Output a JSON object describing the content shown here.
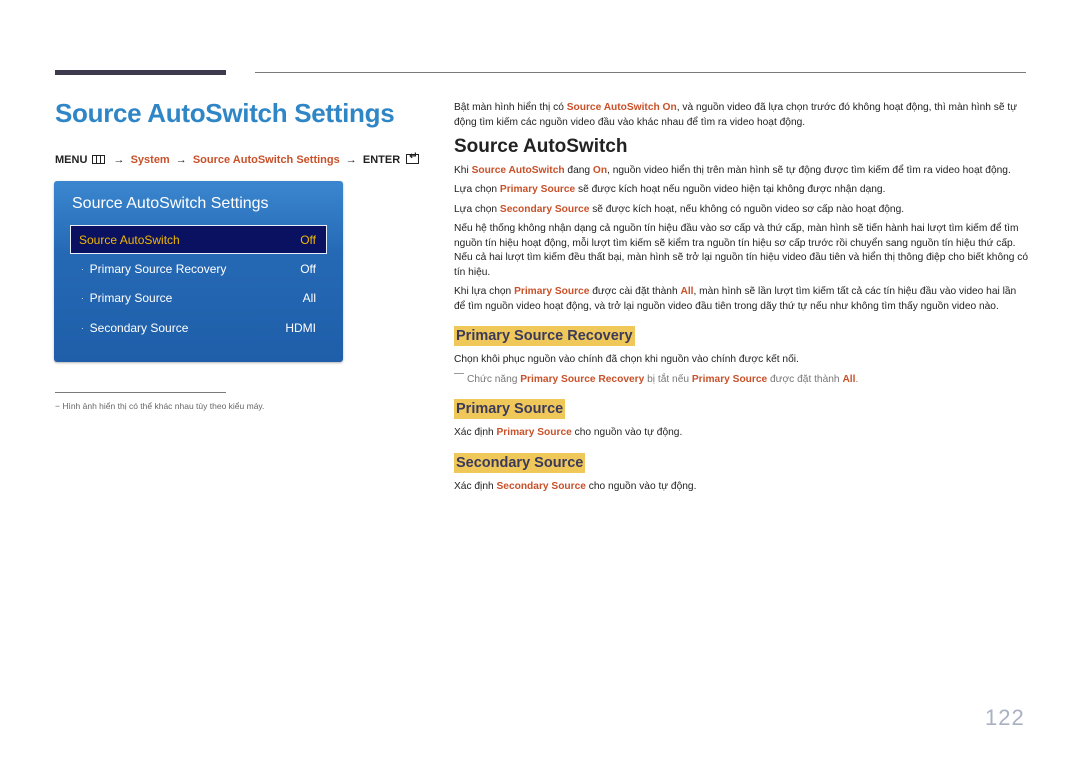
{
  "header": {
    "title": "Source AutoSwitch Settings"
  },
  "menu_path": {
    "menu": "MENU",
    "arrow": "→",
    "system": "System",
    "settings": "Source AutoSwitch Settings",
    "enter": "ENTER"
  },
  "osd": {
    "title": "Source AutoSwitch Settings",
    "rows": [
      {
        "label": "Source AutoSwitch",
        "value": "Off",
        "selected": true
      },
      {
        "label": "Primary Source Recovery",
        "value": "Off"
      },
      {
        "label": "Primary Source",
        "value": "All"
      },
      {
        "label": "Secondary Source",
        "value": "HDMI"
      }
    ],
    "dot": "·"
  },
  "footnote": "−  Hình ảnh hiển thị có thể khác nhau tùy theo kiểu máy.",
  "intro": {
    "pre": "Bật màn hình hiển thị có ",
    "hl": "Source AutoSwitch On",
    "post": ", và nguồn video đã lựa chọn trước đó không hoạt động, thì màn hình sẽ tự động tìm kiếm các nguồn video đầu vào khác nhau để tìm ra video hoạt động."
  },
  "section_autoswitch": {
    "heading": "Source AutoSwitch",
    "p1": {
      "a": "Khi ",
      "b": "Source AutoSwitch",
      "c": " đang ",
      "d": "On",
      "e": ", nguồn video hiển thị trên màn hình sẽ tự động được tìm kiếm để tìm ra video hoạt động."
    },
    "p2": {
      "a": "Lựa chọn ",
      "b": "Primary Source",
      "c": " sẽ được kích hoạt nếu nguồn video hiện tại không được nhận dạng."
    },
    "p3": {
      "a": "Lựa chọn ",
      "b": "Secondary Source",
      "c": " sẽ được kích hoạt, nếu không có nguồn video sơ cấp nào hoạt động."
    },
    "p4": "Nếu hệ thống không nhận dạng cả nguồn tín hiệu đầu vào sơ cấp và thứ cấp, màn hình sẽ tiến hành hai lượt tìm kiếm để tìm nguồn tín hiệu hoạt động, mỗi lượt tìm kiếm sẽ kiểm tra nguồn tín hiệu sơ cấp trước rồi chuyển sang nguồn tín hiệu thứ cấp. Nếu cả hai lượt tìm kiếm đều thất bại, màn hình sẽ trở lại nguồn tín hiệu video đầu tiên và hiển thị thông điệp cho biết không có tín hiệu.",
    "p5": {
      "a": "Khi lựa chọn ",
      "b": "Primary Source",
      "c": " được cài đặt thành ",
      "d": "All",
      "e": ", màn hình sẽ lần lượt tìm kiếm tất cả các tín hiệu đầu vào video hai lần để tìm nguồn video hoạt động, và trở lại nguồn video đầu tiên trong dãy thứ tự nếu như không tìm thấy nguồn video nào."
    }
  },
  "section_recovery": {
    "heading": "Primary Source Recovery",
    "p1": "Chọn khôi phục nguồn vào chính đã chọn khi nguồn vào chính được kết nối.",
    "note": {
      "a": "Chức năng ",
      "b": "Primary Source Recovery",
      "c": " bị tắt nếu ",
      "d": "Primary Source",
      "e": " được đặt thành ",
      "f": "All",
      "g": "."
    }
  },
  "section_primary": {
    "heading": "Primary Source",
    "p": {
      "a": "Xác định ",
      "b": "Primary Source",
      "c": " cho nguồn vào tự động."
    }
  },
  "section_secondary": {
    "heading": "Secondary Source",
    "p": {
      "a": "Xác định ",
      "b": "Secondary Source",
      "c": " cho nguồn vào tự động."
    }
  },
  "page_number": "122",
  "colors": {
    "title_blue": "#2f86c7",
    "highlight_orange": "#c9512a",
    "heading_bg": "#f0c85a",
    "osd_blue": "#2569b5",
    "osd_selected_text": "#f0b800"
  }
}
